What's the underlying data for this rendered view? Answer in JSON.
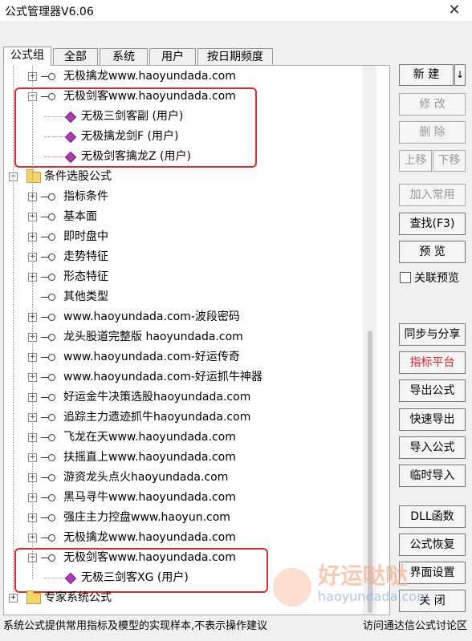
{
  "window": {
    "title": "公式管理器V6.06",
    "close_glyph": "✕"
  },
  "tabs": [
    "公式组",
    "全部",
    "系统",
    "用户",
    "按日期频度"
  ],
  "tree": [
    {
      "label": "无极擒龙www.haoyundada.com",
      "kind": "formula",
      "level": 1,
      "expander": "+"
    },
    {
      "label": "无极剑客www.haoyundada.com",
      "kind": "formula",
      "level": 1,
      "expander": "-"
    },
    {
      "label": "无极三剑客副 (用户)",
      "kind": "user",
      "level": 2
    },
    {
      "label": "无极擒龙剑F (用户)",
      "kind": "user",
      "level": 2
    },
    {
      "label": "无极剑客擒龙Z (用户)",
      "kind": "user",
      "level": 2
    },
    {
      "label": "条件选股公式",
      "kind": "folder",
      "level": 0,
      "expander": "-"
    },
    {
      "label": "指标条件",
      "kind": "formula",
      "level": 1,
      "expander": "+"
    },
    {
      "label": "基本面",
      "kind": "formula",
      "level": 1,
      "expander": "+"
    },
    {
      "label": "即时盘中",
      "kind": "formula",
      "level": 1,
      "expander": "+"
    },
    {
      "label": "走势特征",
      "kind": "formula",
      "level": 1,
      "expander": "+"
    },
    {
      "label": "形态特征",
      "kind": "formula",
      "level": 1,
      "expander": "+"
    },
    {
      "label": "其他类型",
      "kind": "formula",
      "level": 1
    },
    {
      "label": "www.haoyundada.com-波段密码",
      "kind": "formula",
      "level": 1,
      "expander": "+"
    },
    {
      "label": "龙头股道完整版 haoyundada.com",
      "kind": "formula",
      "level": 1,
      "expander": "+"
    },
    {
      "label": "www.haoyundada.com-好运传奇",
      "kind": "formula",
      "level": 1,
      "expander": "+"
    },
    {
      "label": "www.haoyundada.com-好运抓牛神器",
      "kind": "formula",
      "level": 1,
      "expander": "+"
    },
    {
      "label": "好运金牛决策选股haoyundada.com",
      "kind": "formula",
      "level": 1,
      "expander": "+"
    },
    {
      "label": "追踪主力遗迹抓牛haoyundada.com",
      "kind": "formula",
      "level": 1,
      "expander": "+"
    },
    {
      "label": "飞龙在天www.haoyundada.com",
      "kind": "formula",
      "level": 1,
      "expander": "+"
    },
    {
      "label": "扶摇直上www.haoyundada.com",
      "kind": "formula",
      "level": 1,
      "expander": "+"
    },
    {
      "label": "游资龙头点火haoyundada.com",
      "kind": "formula",
      "level": 1,
      "expander": "+"
    },
    {
      "label": "黑马寻牛www.haoyundada.com",
      "kind": "formula",
      "level": 1,
      "expander": "+"
    },
    {
      "label": "强庄主力控盘www.haoyun.com",
      "kind": "formula",
      "level": 1,
      "expander": "+"
    },
    {
      "label": "无极擒龙www.haoyundada.com",
      "kind": "formula",
      "level": 1,
      "expander": "+"
    },
    {
      "label": "无极剑客www.haoyundada.com",
      "kind": "formula",
      "level": 1,
      "expander": "-"
    },
    {
      "label": "无极三剑客XG (用户)",
      "kind": "user",
      "level": 2
    },
    {
      "label": "专家系统公式",
      "kind": "folder",
      "level": 0,
      "expander": "+"
    }
  ],
  "buttons": {
    "new": "新 建",
    "new_arrow": "↓",
    "edit": "修 改",
    "delete": "删 除",
    "move_up": "上移",
    "move_down": "下移",
    "add_common": "加入常用",
    "find": "查找(F3)",
    "preview": "预 览",
    "linked_preview": "关联预览",
    "sync_share": "同步与分享",
    "indicator_platform": "指标平台",
    "export": "导出公式",
    "quick_export": "快速导出",
    "import": "导入公式",
    "temp_import": "临时导入",
    "dll": "DLL函数",
    "restore": "公式恢复",
    "ui_settings": "界面设置",
    "close": "关 闭"
  },
  "status": {
    "left": "系统公式提供常用指标及模型的实现样本,不表示操作建议",
    "right": "访问通达信公式讨论区"
  },
  "watermark": {
    "text": "好运哒哒",
    "url": "haoyundada.com"
  }
}
